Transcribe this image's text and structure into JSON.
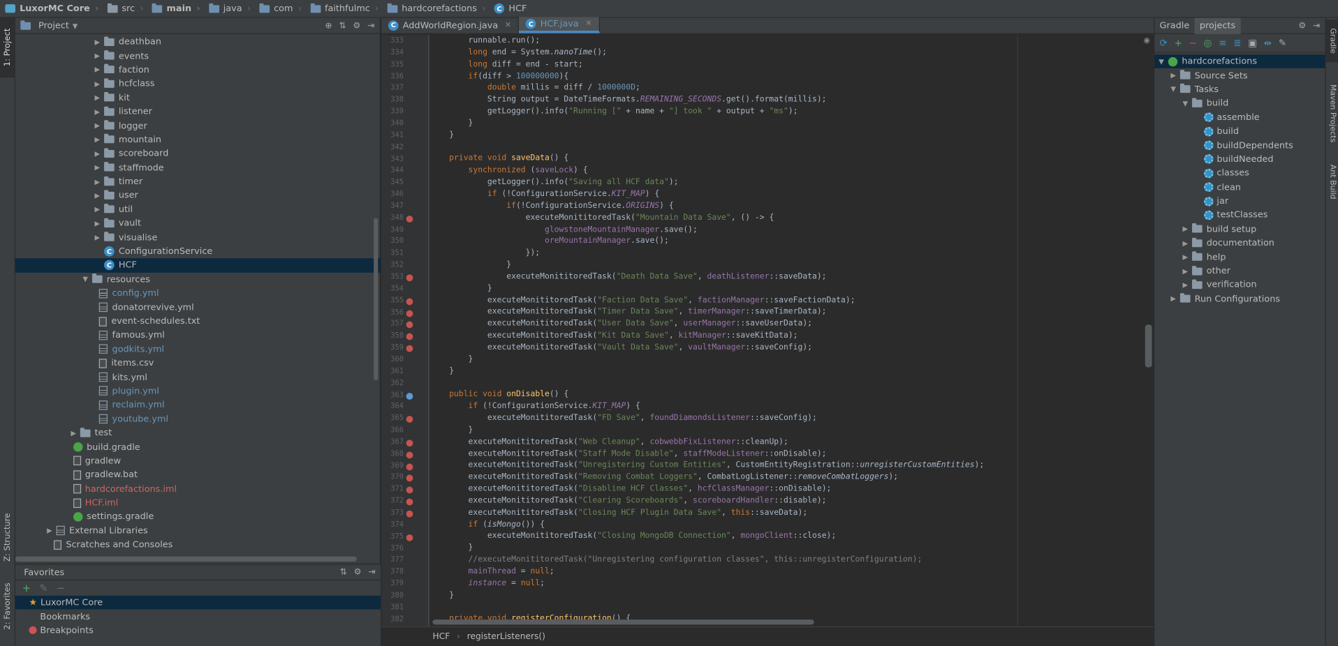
{
  "breadcrumbs": [
    {
      "label": "LuxorMC Core",
      "icon": "module-icon",
      "bold": true
    },
    {
      "label": "src",
      "icon": "folder-icon"
    },
    {
      "label": "main",
      "icon": "folder-icon",
      "bold": true
    },
    {
      "label": "java",
      "icon": "folder-icon"
    },
    {
      "label": "com",
      "icon": "folder-icon"
    },
    {
      "label": "faithfulmc",
      "icon": "folder-icon"
    },
    {
      "label": "hardcorefactions",
      "icon": "folder-icon"
    },
    {
      "label": "HCF",
      "icon": "class-icon"
    }
  ],
  "left_strip": {
    "project": "1: Project",
    "structure": "Z: Structure",
    "favorites": "2: Favorites"
  },
  "project_panel": {
    "title": "Project",
    "tree": [
      {
        "label": "deathban",
        "type": "folder",
        "indent": 1,
        "arrow": "▶"
      },
      {
        "label": "events",
        "type": "folder",
        "indent": 1,
        "arrow": "▶"
      },
      {
        "label": "faction",
        "type": "folder",
        "indent": 1,
        "arrow": "▶"
      },
      {
        "label": "hcfclass",
        "type": "folder",
        "indent": 1,
        "arrow": "▶"
      },
      {
        "label": "kit",
        "type": "folder",
        "indent": 1,
        "arrow": "▶"
      },
      {
        "label": "listener",
        "type": "folder",
        "indent": 1,
        "arrow": "▶"
      },
      {
        "label": "logger",
        "type": "folder",
        "indent": 1,
        "arrow": "▶"
      },
      {
        "label": "mountain",
        "type": "folder",
        "indent": 1,
        "arrow": "▶"
      },
      {
        "label": "scoreboard",
        "type": "folder",
        "indent": 1,
        "arrow": "▶"
      },
      {
        "label": "staffmode",
        "type": "folder",
        "indent": 1,
        "arrow": "▶"
      },
      {
        "label": "timer",
        "type": "folder",
        "indent": 1,
        "arrow": "▶"
      },
      {
        "label": "user",
        "type": "folder",
        "indent": 1,
        "arrow": "▶"
      },
      {
        "label": "util",
        "type": "folder",
        "indent": 1,
        "arrow": "▶"
      },
      {
        "label": "vault",
        "type": "folder",
        "indent": 1,
        "arrow": "▶"
      },
      {
        "label": "visualise",
        "type": "folder",
        "indent": 1,
        "arrow": "▶"
      },
      {
        "label": "ConfigurationService",
        "type": "class",
        "indent": 1,
        "arrow": ""
      },
      {
        "label": "HCF",
        "type": "class",
        "indent": 1,
        "arrow": "",
        "selected": true
      },
      {
        "label": "resources",
        "type": "resfolder",
        "indent": 0,
        "arrow": "▼"
      },
      {
        "label": "config.yml",
        "type": "yml",
        "indent": 0.6,
        "arrow": "",
        "color": "blue"
      },
      {
        "label": "donatorrevive.yml",
        "type": "yml",
        "indent": 0.6,
        "arrow": ""
      },
      {
        "label": "event-schedules.txt",
        "type": "txt",
        "indent": 0.6,
        "arrow": ""
      },
      {
        "label": "famous.yml",
        "type": "yml",
        "indent": 0.6,
        "arrow": ""
      },
      {
        "label": "godkits.yml",
        "type": "yml",
        "indent": 0.6,
        "arrow": "",
        "color": "blue"
      },
      {
        "label": "items.csv",
        "type": "txt",
        "indent": 0.6,
        "arrow": ""
      },
      {
        "label": "kits.yml",
        "type": "yml",
        "indent": 0.6,
        "arrow": ""
      },
      {
        "label": "plugin.yml",
        "type": "yml",
        "indent": 0.6,
        "arrow": "",
        "color": "blue"
      },
      {
        "label": "reclaim.yml",
        "type": "yml",
        "indent": 0.6,
        "arrow": "",
        "color": "blue"
      },
      {
        "label": "youtube.yml",
        "type": "yml",
        "indent": 0.6,
        "arrow": "",
        "color": "blue"
      },
      {
        "label": "test",
        "type": "folder",
        "indent": -1,
        "arrow": "▶"
      },
      {
        "label": "build.gradle",
        "type": "gradle",
        "indent": -1.6,
        "arrow": ""
      },
      {
        "label": "gradlew",
        "type": "txt",
        "indent": -1.6,
        "arrow": ""
      },
      {
        "label": "gradlew.bat",
        "type": "txt",
        "indent": -1.6,
        "arrow": ""
      },
      {
        "label": "hardcorefactions.iml",
        "type": "txt",
        "indent": -1.6,
        "arrow": "",
        "color": "red"
      },
      {
        "label": "HCF.iml",
        "type": "txt",
        "indent": -1.6,
        "arrow": "",
        "color": "red"
      },
      {
        "label": "settings.gradle",
        "type": "gradle",
        "indent": -1.6,
        "arrow": ""
      },
      {
        "label": "External Libraries",
        "type": "lib",
        "indent": -3,
        "arrow": "▶"
      },
      {
        "label": "Scratches and Consoles",
        "type": "scratch",
        "indent": -3.2,
        "arrow": ""
      }
    ]
  },
  "favorites": {
    "title": "Favorites",
    "items": [
      {
        "label": "LuxorMC Core",
        "icon": "star",
        "selected": true
      },
      {
        "label": "Bookmarks",
        "icon": "none"
      },
      {
        "label": "Breakpoints",
        "icon": "breakpoint"
      }
    ]
  },
  "editor": {
    "tabs": [
      {
        "label": "AddWorldRegion.java",
        "active": false
      },
      {
        "label": "HCF.java",
        "active": true
      }
    ],
    "breadcrumb": [
      "HCF",
      "registerListeners()"
    ],
    "lines": [
      {
        "n": 333,
        "html": "        runnable.run();"
      },
      {
        "n": 334,
        "html": "        <span class='k'>long</span> end = System.<span class='it'>nanoTime</span>();"
      },
      {
        "n": 335,
        "html": "        <span class='k'>long</span> diff = end - start;"
      },
      {
        "n": 336,
        "html": "        <span class='k'>if</span>(diff &gt; <span class='n'>100000000</span>){"
      },
      {
        "n": 337,
        "html": "            <span class='k'>double</span> millis = diff / <span class='n'>1000000D</span>;"
      },
      {
        "n": 338,
        "html": "            String output = DateTimeFormats.<span class='fi'>REMAINING_SECONDS</span>.get().format(millis);"
      },
      {
        "n": 339,
        "html": "            getLogger().info(<span class='s'>\"Running [\"</span> + name + <span class='s'>\"] took \"</span> + output + <span class='s'>\"ms\"</span>);"
      },
      {
        "n": 340,
        "html": "        }"
      },
      {
        "n": 341,
        "html": "    }"
      },
      {
        "n": 342,
        "html": ""
      },
      {
        "n": 343,
        "html": "    <span class='k'>private void</span> <span class='m'>saveData</span>() {"
      },
      {
        "n": 344,
        "html": "        <span class='k'>synchronized</span> (<span class='f'>saveLock</span>) {"
      },
      {
        "n": 345,
        "html": "            getLogger().info(<span class='s'>\"Saving all HCF data\"</span>);"
      },
      {
        "n": 346,
        "html": "            <span class='k'>if</span> (!ConfigurationService.<span class='fi'>KIT_MAP</span>) {"
      },
      {
        "n": 347,
        "html": "                <span class='k'>if</span>(!ConfigurationService.<span class='fi'>ORIGINS</span>) {"
      },
      {
        "n": 348,
        "html": "                    executeMonititoredTask(<span class='s'>\"Mountain Data Save\"</span>, () -&gt; {",
        "mark": "red"
      },
      {
        "n": 349,
        "html": "                        <span class='f'>glowstoneMountainManager</span>.save();"
      },
      {
        "n": 350,
        "html": "                        <span class='f'>oreMountainManager</span>.save();"
      },
      {
        "n": 351,
        "html": "                    });"
      },
      {
        "n": 352,
        "html": "                }"
      },
      {
        "n": 353,
        "html": "                executeMonititoredTask(<span class='s'>\"Death Data Save\"</span>, <span class='f'>deathListener</span>::saveData);",
        "mark": "red"
      },
      {
        "n": 354,
        "html": "            }"
      },
      {
        "n": 355,
        "html": "            executeMonititoredTask(<span class='s'>\"Faction Data Save\"</span>, <span class='f'>factionManager</span>::saveFactionData);",
        "mark": "red"
      },
      {
        "n": 356,
        "html": "            executeMonititoredTask(<span class='s'>\"Timer Data Save\"</span>, <span class='f'>timerManager</span>::saveTimerData);",
        "mark": "red"
      },
      {
        "n": 357,
        "html": "            executeMonititoredTask(<span class='s'>\"User Data Save\"</span>, <span class='f'>userManager</span>::saveUserData);",
        "mark": "red"
      },
      {
        "n": 358,
        "html": "            executeMonititoredTask(<span class='s'>\"Kit Data Save\"</span>, <span class='f'>kitManager</span>::saveKitData);",
        "mark": "red"
      },
      {
        "n": 359,
        "html": "            executeMonititoredTask(<span class='s'>\"Vault Data Save\"</span>, <span class='f'>vaultManager</span>::saveConfig);",
        "mark": "red"
      },
      {
        "n": 360,
        "html": "        }"
      },
      {
        "n": 361,
        "html": "    }"
      },
      {
        "n": 362,
        "html": ""
      },
      {
        "n": 363,
        "html": "    <span class='k'>public void</span> <span class='m'>onDisable</span>() {",
        "mark": "blue"
      },
      {
        "n": 364,
        "html": "        <span class='k'>if</span> (!ConfigurationService.<span class='fi'>KIT_MAP</span>) {"
      },
      {
        "n": 365,
        "html": "            executeMonititoredTask(<span class='s'>\"FD Save\"</span>, <span class='f'>foundDiamondsListener</span>::saveConfig);",
        "mark": "red"
      },
      {
        "n": 366,
        "html": "        }"
      },
      {
        "n": 367,
        "html": "        executeMonititoredTask(<span class='s'>\"Web Cleanup\"</span>, <span class='f'>cobwebbFixListener</span>::cleanUp);",
        "mark": "red"
      },
      {
        "n": 368,
        "html": "        executeMonititoredTask(<span class='s'>\"Staff Mode Disable\"</span>, <span class='f'>staffModeListener</span>::onDisable);",
        "mark": "red"
      },
      {
        "n": 369,
        "html": "        executeMonititoredTask(<span class='s'>\"Unregistering Custom Entities\"</span>, CustomEntityRegistration::<span class='it'>unregisterCustomEntities</span>);",
        "mark": "red"
      },
      {
        "n": 370,
        "html": "        executeMonititoredTask(<span class='s'>\"Removing Combat Loggers\"</span>, CombatLogListener::<span class='it'>removeCombatLoggers</span>);",
        "mark": "red"
      },
      {
        "n": 371,
        "html": "        executeMonititoredTask(<span class='s'>\"Disabline HCF Classes\"</span>, <span class='f'>hcfClassManager</span>::onDisable);",
        "mark": "red"
      },
      {
        "n": 372,
        "html": "        executeMonititoredTask(<span class='s'>\"Clearing Scoreboards\"</span>, <span class='f'>scoreboardHandler</span>::disable);",
        "mark": "red"
      },
      {
        "n": 373,
        "html": "        executeMonititoredTask(<span class='s'>\"Closing HCF Plugin Data Save\"</span>, <span class='k'>this</span>::saveData);",
        "mark": "red"
      },
      {
        "n": 374,
        "html": "        <span class='k'>if</span> (<span class='it'>isMongo</span>()) {"
      },
      {
        "n": 375,
        "html": "            executeMonititoredTask(<span class='s'>\"Closing MongoDB Connection\"</span>, <span class='f'>mongoClient</span>::close);",
        "mark": "red"
      },
      {
        "n": 376,
        "html": "        }"
      },
      {
        "n": 377,
        "html": "        <span class='c'>//executeMonititoredTask(\"Unregistering configuration classes\", this::unregisterConfiguration);</span>"
      },
      {
        "n": 378,
        "html": "        <span class='f'>mainThread</span> = <span class='k'>null</span>;"
      },
      {
        "n": 379,
        "html": "        <span class='fi'>instance</span> = <span class='k'>null</span>;"
      },
      {
        "n": 380,
        "html": "    }"
      },
      {
        "n": 381,
        "html": ""
      },
      {
        "n": 382,
        "html": "    <span class='k'>private void</span> <span class='m'>registerConfiguration</span>() {"
      }
    ]
  },
  "gradle_panel": {
    "tabs": [
      "Gradle",
      "projects"
    ],
    "tree": [
      {
        "label": "hardcorefactions",
        "indent": 0,
        "arrow": "▼",
        "icon": "gradle",
        "selected": true
      },
      {
        "label": "Source Sets",
        "indent": 1,
        "arrow": "▶",
        "icon": "folder"
      },
      {
        "label": "Tasks",
        "indent": 1,
        "arrow": "▼",
        "icon": "folder"
      },
      {
        "label": "build",
        "indent": 2,
        "arrow": "▼",
        "icon": "folder"
      },
      {
        "label": "assemble",
        "indent": 3,
        "arrow": "",
        "icon": "gear"
      },
      {
        "label": "build",
        "indent": 3,
        "arrow": "",
        "icon": "gear"
      },
      {
        "label": "buildDependents",
        "indent": 3,
        "arrow": "",
        "icon": "gear"
      },
      {
        "label": "buildNeeded",
        "indent": 3,
        "arrow": "",
        "icon": "gear"
      },
      {
        "label": "classes",
        "indent": 3,
        "arrow": "",
        "icon": "gear"
      },
      {
        "label": "clean",
        "indent": 3,
        "arrow": "",
        "icon": "gear"
      },
      {
        "label": "jar",
        "indent": 3,
        "arrow": "",
        "icon": "gear"
      },
      {
        "label": "testClasses",
        "indent": 3,
        "arrow": "",
        "icon": "gear"
      },
      {
        "label": "build setup",
        "indent": 2,
        "arrow": "▶",
        "icon": "folder"
      },
      {
        "label": "documentation",
        "indent": 2,
        "arrow": "▶",
        "icon": "folder"
      },
      {
        "label": "help",
        "indent": 2,
        "arrow": "▶",
        "icon": "folder"
      },
      {
        "label": "other",
        "indent": 2,
        "arrow": "▶",
        "icon": "folder"
      },
      {
        "label": "verification",
        "indent": 2,
        "arrow": "▶",
        "icon": "folder"
      },
      {
        "label": "Run Configurations",
        "indent": 1,
        "arrow": "▶",
        "icon": "folder"
      }
    ]
  },
  "right_strip": {
    "gradle": "Gradle",
    "maven": "Maven Projects",
    "ant": "Ant Build"
  }
}
